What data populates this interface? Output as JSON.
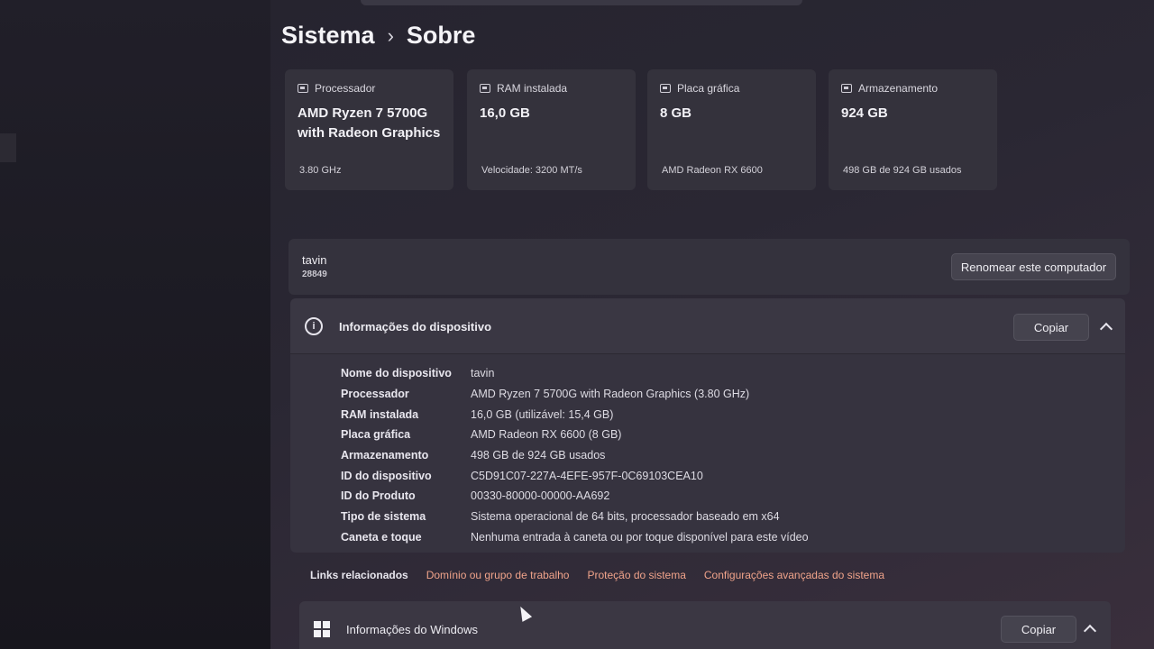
{
  "breadcrumb": {
    "parent": "Sistema",
    "separator": "›",
    "current": "Sobre"
  },
  "cards": [
    {
      "label": "Processador",
      "value": "AMD Ryzen 7 5700G with Radeon Graphics",
      "footer": "3.80 GHz"
    },
    {
      "label": "RAM instalada",
      "value": "16,0 GB",
      "footer": "Velocidade: 3200 MT/s"
    },
    {
      "label": "Placa gráfica",
      "value": "8 GB",
      "footer": "AMD Radeon RX 6600"
    },
    {
      "label": "Armazenamento",
      "value": "924 GB",
      "footer": "498 GB de 924 GB usados"
    }
  ],
  "computer": {
    "name": "tavin",
    "sub": "28849",
    "rename_label": "Renomear este computador"
  },
  "device_info": {
    "title": "Informações do dispositivo",
    "copy_label": "Copiar",
    "rows": [
      {
        "label": "Nome do dispositivo",
        "value": "tavin"
      },
      {
        "label": "Processador",
        "value": "AMD Ryzen 7 5700G with Radeon Graphics (3.80 GHz)"
      },
      {
        "label": "RAM instalada",
        "value": "16,0 GB (utilizável: 15,4 GB)"
      },
      {
        "label": "Placa gráfica",
        "value": "AMD Radeon RX 6600 (8 GB)"
      },
      {
        "label": "Armazenamento",
        "value": "498 GB de 924 GB usados"
      },
      {
        "label": "ID do dispositivo",
        "value": "C5D91C07-227A-4EFE-957F-0C69103CEA10"
      },
      {
        "label": "ID do Produto",
        "value": "00330-80000-00000-AA692"
      },
      {
        "label": "Tipo de sistema",
        "value": "Sistema operacional de 64 bits, processador baseado em x64"
      },
      {
        "label": "Caneta e toque",
        "value": "Nenhuma entrada à caneta ou por toque disponível para este vídeo"
      }
    ]
  },
  "related_links": {
    "label": "Links relacionados",
    "links": [
      "Domínio ou grupo de trabalho",
      "Proteção do sistema",
      "Configurações avançadas do sistema"
    ],
    "color": "#f0a38a"
  },
  "windows_info": {
    "title": "Informações do Windows",
    "copy_label": "Copiar"
  }
}
